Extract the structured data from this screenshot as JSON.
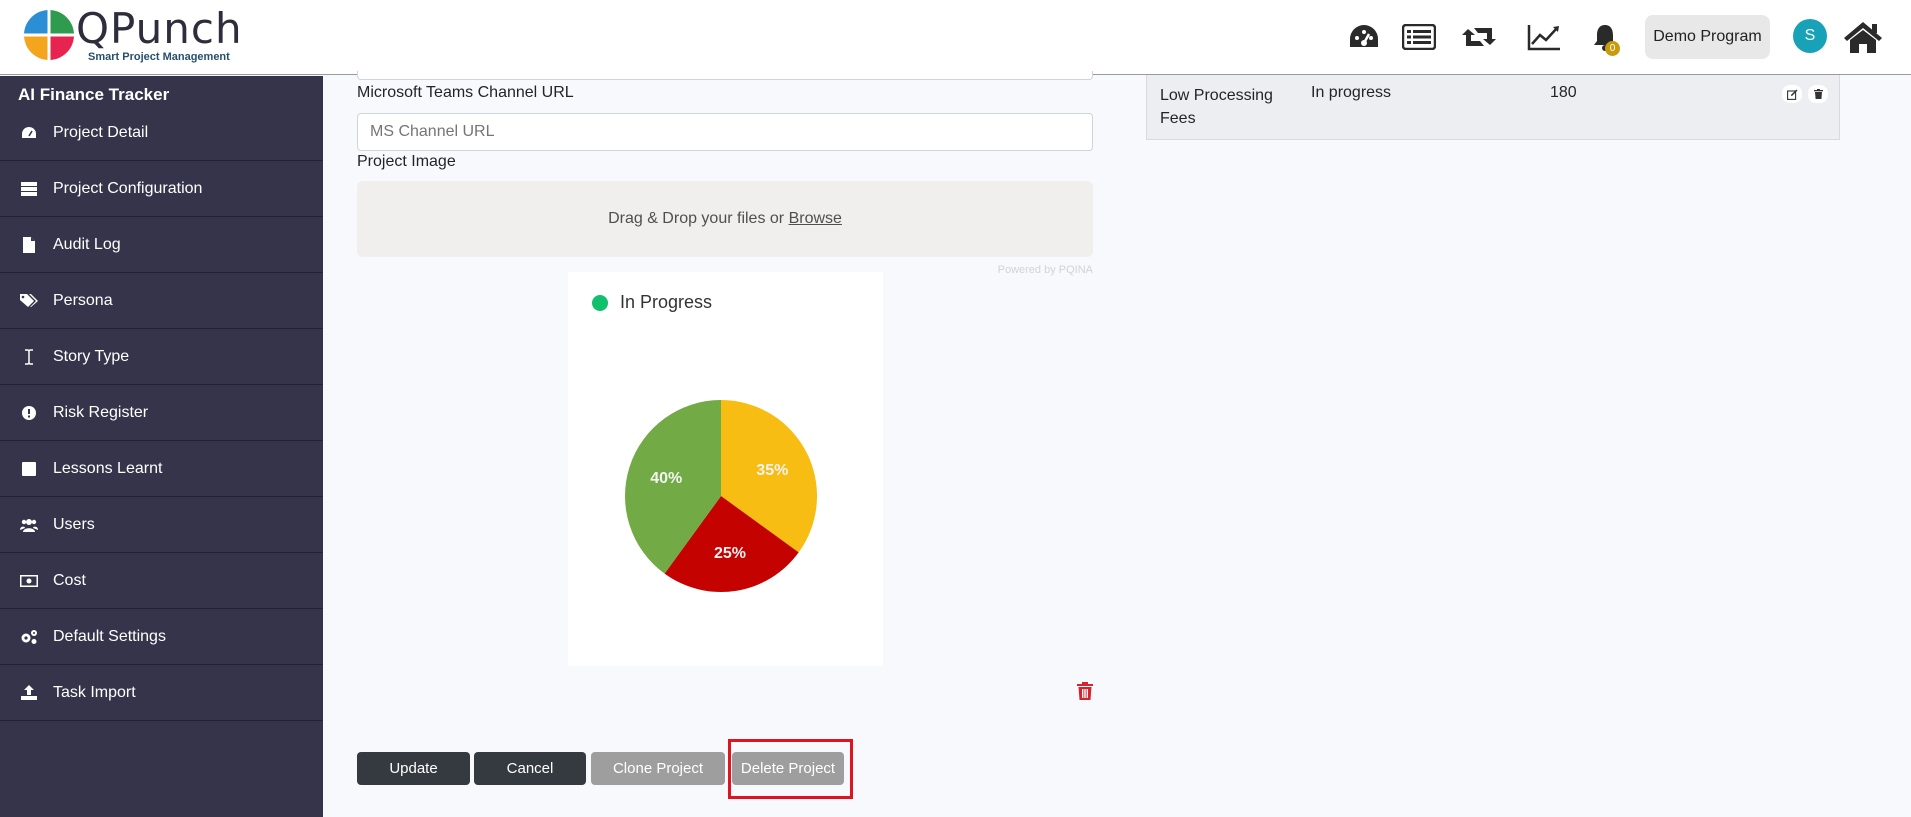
{
  "brand": {
    "name": "QPunch",
    "tagline": "Smart Project Management"
  },
  "header": {
    "program_button": "Demo Program",
    "notification_count": "0",
    "avatar_initial": "S",
    "icons": [
      "dashboard-icon",
      "list-icon",
      "retweet-icon",
      "chart-line-icon",
      "bell-icon",
      "home-icon"
    ]
  },
  "sidebar": {
    "title": "AI Finance Tracker",
    "items": [
      {
        "label": "Project Detail",
        "icon": "tachometer-icon"
      },
      {
        "label": "Project Configuration",
        "icon": "server-icon"
      },
      {
        "label": "Audit Log",
        "icon": "file-icon"
      },
      {
        "label": "Persona",
        "icon": "tags-icon"
      },
      {
        "label": "Story Type",
        "icon": "i-cursor-icon"
      },
      {
        "label": "Risk Register",
        "icon": "exclamation-circle-icon"
      },
      {
        "label": "Lessons Learnt",
        "icon": "square-icon"
      },
      {
        "label": "Users",
        "icon": "users-icon"
      },
      {
        "label": "Cost",
        "icon": "money-icon"
      },
      {
        "label": "Default Settings",
        "icon": "cogs-icon"
      },
      {
        "label": "Task Import",
        "icon": "upload-icon"
      }
    ]
  },
  "form": {
    "teams_label": "Microsoft Teams Channel URL",
    "teams_placeholder": "MS Channel URL",
    "image_label": "Project Image",
    "drop_text": "Drag & Drop your files or ",
    "browse": "Browse",
    "powered_by": "Powered by PQINA"
  },
  "chart_data": {
    "type": "pie",
    "legend": [
      "In Progress"
    ],
    "legend_color": "#11c06a",
    "slices": [
      {
        "label": "35%",
        "value": 35,
        "color": "#f7bd12"
      },
      {
        "label": "25%",
        "value": 25,
        "color": "#c40200"
      },
      {
        "label": "40%",
        "value": 40,
        "color": "#72ab46"
      }
    ]
  },
  "buttons": {
    "update": "Update",
    "cancel": "Cancel",
    "clone": "Clone Project",
    "delete": "Delete Project"
  },
  "table": {
    "row": {
      "name_line1": "Low Processing",
      "name_line2": "Fees",
      "status": "In progress",
      "value": "180"
    }
  }
}
